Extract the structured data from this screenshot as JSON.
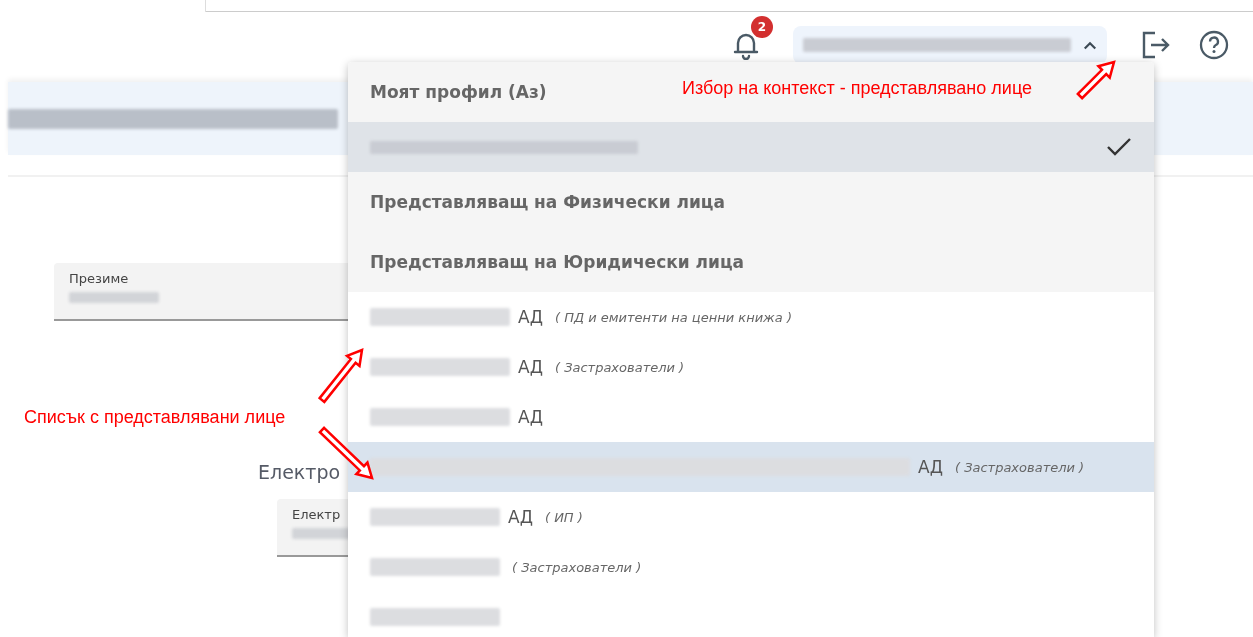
{
  "header": {
    "notifications": {
      "count": "2"
    },
    "context_selector": {
      "expanded": true
    }
  },
  "page": {
    "fields": [
      {
        "label": "Презиме"
      }
    ],
    "section_title": "Електро",
    "section_fields": [
      {
        "label": "Електр"
      }
    ]
  },
  "context_menu": {
    "items": [
      {
        "kind": "option",
        "label": "Моят профил (Аз)",
        "selected": false,
        "highlighted": false
      },
      {
        "kind": "person",
        "selected": true,
        "highlighted": false
      },
      {
        "kind": "option",
        "label": "Представляващ на Физически лица",
        "selected": false,
        "highlighted": false
      },
      {
        "kind": "option",
        "label": "Представляващ на Юридически лица",
        "selected": false,
        "highlighted": false
      },
      {
        "kind": "entity",
        "suffix": "АД",
        "note": "( ПД и емитенти на ценни книжа )",
        "selected": false,
        "highlighted": false
      },
      {
        "kind": "entity",
        "suffix": "АД",
        "note": "( Застрахователи )",
        "selected": false,
        "highlighted": false
      },
      {
        "kind": "entity",
        "suffix": "АД",
        "selected": false,
        "highlighted": false
      },
      {
        "kind": "entity",
        "suffix": "АД",
        "note": "( Застрахователи )",
        "selected": false,
        "highlighted": true
      },
      {
        "kind": "entity",
        "suffix": "АД",
        "note": "( ИП )",
        "selected": false,
        "highlighted": false
      },
      {
        "kind": "entity",
        "note": "( Застрахователи )",
        "selected": false,
        "highlighted": false
      },
      {
        "kind": "entity",
        "selected": false,
        "highlighted": false
      }
    ]
  },
  "annotations": [
    {
      "text": "Избор на контекст - представлявано лице"
    },
    {
      "text": "Списък с представлявани лице"
    }
  ]
}
